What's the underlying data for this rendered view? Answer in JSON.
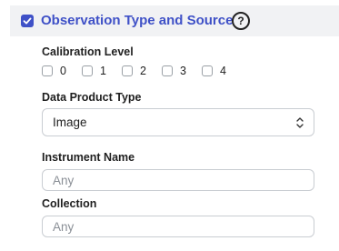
{
  "section": {
    "title": "Observation Type and Source",
    "checked": true,
    "help_icon": "question-circle-icon",
    "accent_color": "#3f51c7"
  },
  "calibration_level": {
    "label": "Calibration Level",
    "options": [
      "0",
      "1",
      "2",
      "3",
      "4"
    ]
  },
  "data_product_type": {
    "label": "Data Product Type",
    "value": "Image"
  },
  "instrument_name": {
    "label": "Instrument Name",
    "placeholder": "Any"
  },
  "collection": {
    "label": "Collection",
    "placeholder": "Any"
  }
}
